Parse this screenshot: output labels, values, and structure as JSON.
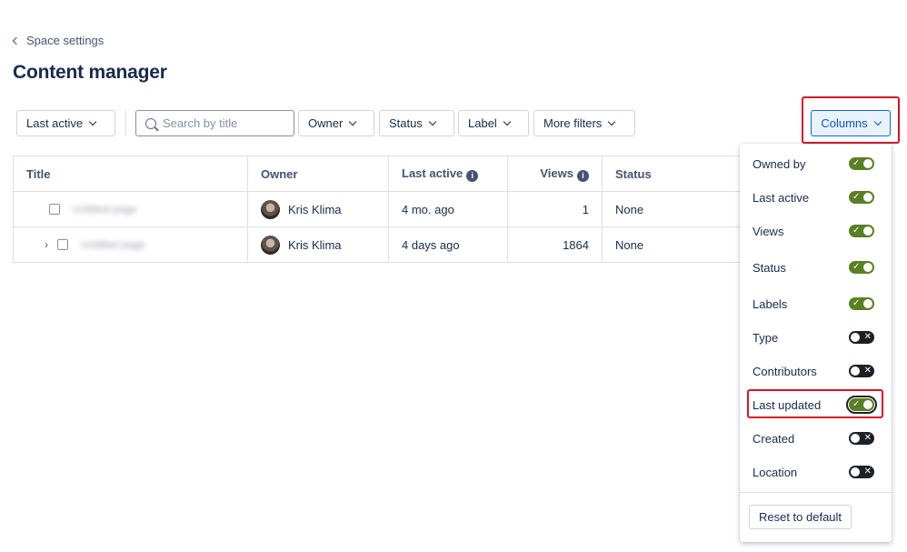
{
  "breadcrumb": {
    "back_label": "Space settings"
  },
  "page": {
    "title": "Content manager"
  },
  "filters": {
    "sort": "Last active",
    "search_placeholder": "Search by title",
    "owner": "Owner",
    "status": "Status",
    "label": "Label",
    "more": "More filters",
    "columns": "Columns"
  },
  "table": {
    "headers": {
      "title": "Title",
      "owner": "Owner",
      "last_active": "Last active",
      "views": "Views",
      "status": "Status"
    },
    "rows": [
      {
        "title": "Untitled page",
        "owner": "Kris Klima",
        "last_active": "4 mo. ago",
        "views": "1",
        "status": "None",
        "expandable": false
      },
      {
        "title": "Untitled page",
        "owner": "Kris Klima",
        "last_active": "4 days ago",
        "views": "1864",
        "status": "None",
        "expandable": true
      }
    ]
  },
  "columns_menu": {
    "items": [
      {
        "label": "Owned by",
        "enabled": true
      },
      {
        "label": "Last active",
        "enabled": true
      },
      {
        "label": "Views",
        "enabled": true
      },
      {
        "label": "Status",
        "enabled": true
      },
      {
        "label": "Labels",
        "enabled": true
      },
      {
        "label": "Type",
        "enabled": false
      },
      {
        "label": "Contributors",
        "enabled": false
      },
      {
        "label": "Last updated",
        "enabled": true
      },
      {
        "label": "Created",
        "enabled": false
      },
      {
        "label": "Location",
        "enabled": false
      }
    ],
    "reset_label": "Reset to default"
  },
  "icons": {
    "on": "checkmark-icon",
    "off": "cross-icon",
    "info": "info-icon",
    "search": "search-icon"
  },
  "colors": {
    "toggle_on": "#5b7f24",
    "toggle_off": "#1d2125",
    "highlight": "#d7142b",
    "accent": "#0c66e4"
  }
}
